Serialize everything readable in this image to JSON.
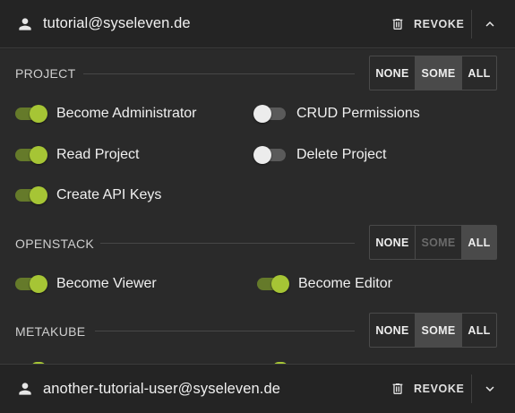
{
  "users": [
    {
      "email": "tutorial@syseleven.de",
      "revoke_label": "REVOKE",
      "expanded": true
    },
    {
      "email": "another-tutorial-user@syseleven.de",
      "revoke_label": "REVOKE",
      "expanded": false
    }
  ],
  "sections": [
    {
      "title": "PROJECT",
      "options": [
        "NONE",
        "SOME",
        "ALL"
      ],
      "selected": "SOME",
      "permissions": [
        {
          "label": "Become Administrator",
          "enabled": true
        },
        {
          "label": "CRUD Permissions",
          "enabled": false
        },
        {
          "label": "Read Project",
          "enabled": true
        },
        {
          "label": "Delete Project",
          "enabled": false
        },
        {
          "label": "Create API Keys",
          "enabled": true
        }
      ]
    },
    {
      "title": "OPENSTACK",
      "options": [
        "NONE",
        "SOME",
        "ALL"
      ],
      "selected": "ALL",
      "disabled_options": [
        "SOME"
      ],
      "permissions": [
        {
          "label": "Become Viewer",
          "enabled": true
        },
        {
          "label": "Become Editor",
          "enabled": true
        }
      ]
    },
    {
      "title": "METAKUBE",
      "options": [
        "NONE",
        "SOME",
        "ALL"
      ],
      "selected": "SOME"
    }
  ],
  "colors": {
    "accent": "#a6c535",
    "accent_track": "#657a2a",
    "background": "#242424",
    "panel": "#2a2a2a",
    "selected_segment": "#4a4a4a"
  },
  "icons": {
    "user": "person-icon",
    "revoke": "trash-icon",
    "collapse": "chevron-up-icon",
    "expand": "chevron-down-icon"
  }
}
